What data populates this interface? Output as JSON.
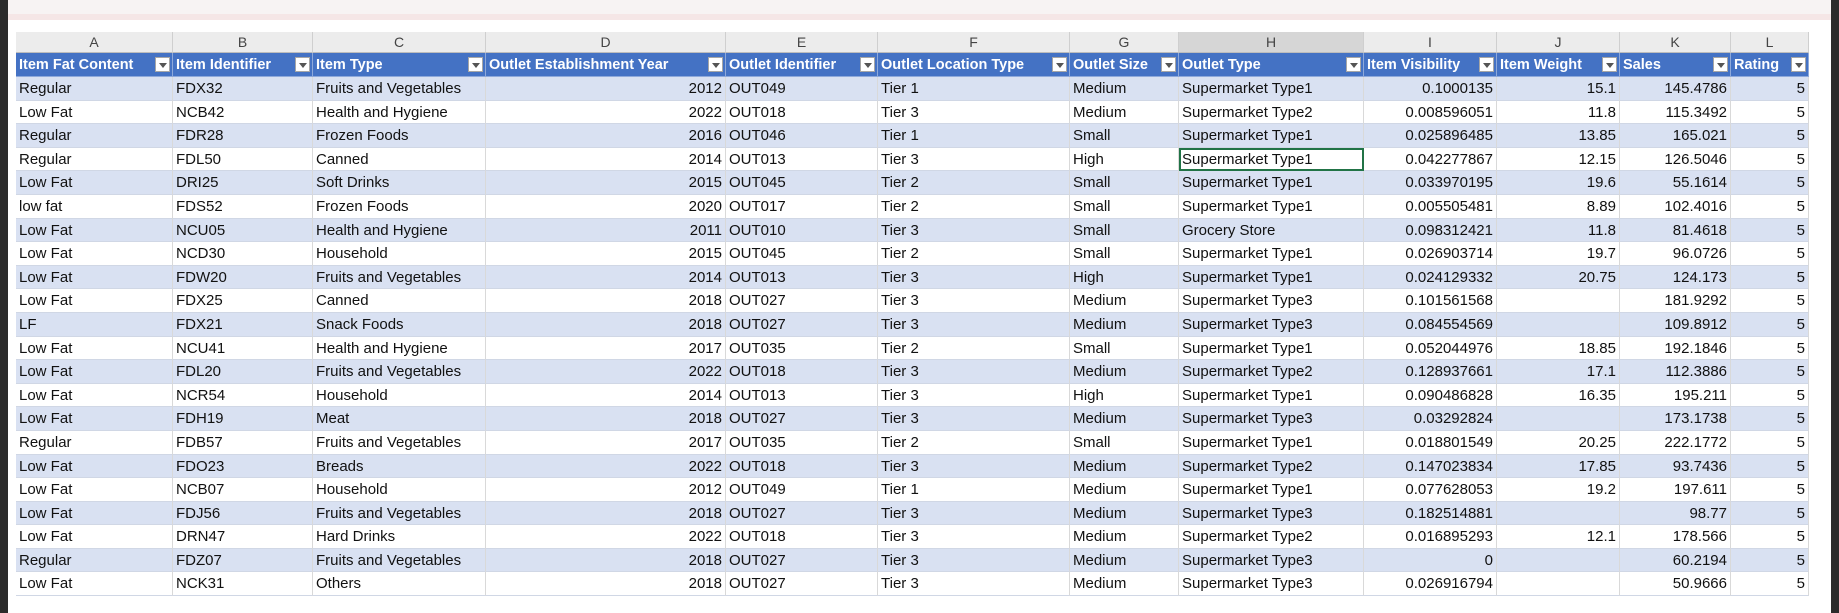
{
  "columns": [
    "A",
    "B",
    "C",
    "D",
    "E",
    "F",
    "G",
    "H",
    "I",
    "J",
    "K",
    "L"
  ],
  "headers": [
    "Item Fat Content",
    "Item Identifier",
    "Item Type",
    "Outlet Establishment Year",
    "Outlet Identifier",
    "Outlet Location Type",
    "Outlet Size",
    "Outlet Type",
    "Item Visibility",
    "Item Weight",
    "Sales",
    "Rating"
  ],
  "rows": [
    [
      "Regular",
      "FDX32",
      "Fruits and Vegetables",
      "2012",
      "OUT049",
      "Tier 1",
      "Medium",
      "Supermarket Type1",
      "0.1000135",
      "15.1",
      "145.4786",
      "5"
    ],
    [
      "Low Fat",
      "NCB42",
      "Health and Hygiene",
      "2022",
      "OUT018",
      "Tier 3",
      "Medium",
      "Supermarket Type2",
      "0.008596051",
      "11.8",
      "115.3492",
      "5"
    ],
    [
      "Regular",
      "FDR28",
      "Frozen Foods",
      "2016",
      "OUT046",
      "Tier 1",
      "Small",
      "Supermarket Type1",
      "0.025896485",
      "13.85",
      "165.021",
      "5"
    ],
    [
      "Regular",
      "FDL50",
      "Canned",
      "2014",
      "OUT013",
      "Tier 3",
      "High",
      "Supermarket Type1",
      "0.042277867",
      "12.15",
      "126.5046",
      "5"
    ],
    [
      "Low Fat",
      "DRI25",
      "Soft Drinks",
      "2015",
      "OUT045",
      "Tier 2",
      "Small",
      "Supermarket Type1",
      "0.033970195",
      "19.6",
      "55.1614",
      "5"
    ],
    [
      "low fat",
      "FDS52",
      "Frozen Foods",
      "2020",
      "OUT017",
      "Tier 2",
      "Small",
      "Supermarket Type1",
      "0.005505481",
      "8.89",
      "102.4016",
      "5"
    ],
    [
      "Low Fat",
      "NCU05",
      "Health and Hygiene",
      "2011",
      "OUT010",
      "Tier 3",
      "Small",
      "Grocery Store",
      "0.098312421",
      "11.8",
      "81.4618",
      "5"
    ],
    [
      "Low Fat",
      "NCD30",
      "Household",
      "2015",
      "OUT045",
      "Tier 2",
      "Small",
      "Supermarket Type1",
      "0.026903714",
      "19.7",
      "96.0726",
      "5"
    ],
    [
      "Low Fat",
      "FDW20",
      "Fruits and Vegetables",
      "2014",
      "OUT013",
      "Tier 3",
      "High",
      "Supermarket Type1",
      "0.024129332",
      "20.75",
      "124.173",
      "5"
    ],
    [
      "Low Fat",
      "FDX25",
      "Canned",
      "2018",
      "OUT027",
      "Tier 3",
      "Medium",
      "Supermarket Type3",
      "0.101561568",
      "",
      "181.9292",
      "5"
    ],
    [
      "LF",
      "FDX21",
      "Snack Foods",
      "2018",
      "OUT027",
      "Tier 3",
      "Medium",
      "Supermarket Type3",
      "0.084554569",
      "",
      "109.8912",
      "5"
    ],
    [
      "Low Fat",
      "NCU41",
      "Health and Hygiene",
      "2017",
      "OUT035",
      "Tier 2",
      "Small",
      "Supermarket Type1",
      "0.052044976",
      "18.85",
      "192.1846",
      "5"
    ],
    [
      "Low Fat",
      "FDL20",
      "Fruits and Vegetables",
      "2022",
      "OUT018",
      "Tier 3",
      "Medium",
      "Supermarket Type2",
      "0.128937661",
      "17.1",
      "112.3886",
      "5"
    ],
    [
      "Low Fat",
      "NCR54",
      "Household",
      "2014",
      "OUT013",
      "Tier 3",
      "High",
      "Supermarket Type1",
      "0.090486828",
      "16.35",
      "195.211",
      "5"
    ],
    [
      "Low Fat",
      "FDH19",
      "Meat",
      "2018",
      "OUT027",
      "Tier 3",
      "Medium",
      "Supermarket Type3",
      "0.03292824",
      "",
      "173.1738",
      "5"
    ],
    [
      "Regular",
      "FDB57",
      "Fruits and Vegetables",
      "2017",
      "OUT035",
      "Tier 2",
      "Small",
      "Supermarket Type1",
      "0.018801549",
      "20.25",
      "222.1772",
      "5"
    ],
    [
      "Low Fat",
      "FDO23",
      "Breads",
      "2022",
      "OUT018",
      "Tier 3",
      "Medium",
      "Supermarket Type2",
      "0.147023834",
      "17.85",
      "93.7436",
      "5"
    ],
    [
      "Low Fat",
      "NCB07",
      "Household",
      "2012",
      "OUT049",
      "Tier 1",
      "Medium",
      "Supermarket Type1",
      "0.077628053",
      "19.2",
      "197.611",
      "5"
    ],
    [
      "Low Fat",
      "FDJ56",
      "Fruits and Vegetables",
      "2018",
      "OUT027",
      "Tier 3",
      "Medium",
      "Supermarket Type3",
      "0.182514881",
      "",
      "98.77",
      "5"
    ],
    [
      "Low Fat",
      "DRN47",
      "Hard Drinks",
      "2022",
      "OUT018",
      "Tier 3",
      "Medium",
      "Supermarket Type2",
      "0.016895293",
      "12.1",
      "178.566",
      "5"
    ],
    [
      "Regular",
      "FDZ07",
      "Fruits and Vegetables",
      "2018",
      "OUT027",
      "Tier 3",
      "Medium",
      "Supermarket Type3",
      "0",
      "",
      "60.2194",
      "5"
    ],
    [
      "Low Fat",
      "NCK31",
      "Others",
      "2018",
      "OUT027",
      "Tier 3",
      "Medium",
      "Supermarket Type3",
      "0.026916794",
      "",
      "50.9666",
      "5"
    ]
  ],
  "selected": {
    "row": 3,
    "col": 7,
    "column_letter": "H"
  },
  "colors": {
    "header_fill": "#4472c4",
    "band_fill": "#d9e1f2",
    "selection": "#217346"
  },
  "icons": {
    "filter": "filter-dropdown-icon"
  }
}
